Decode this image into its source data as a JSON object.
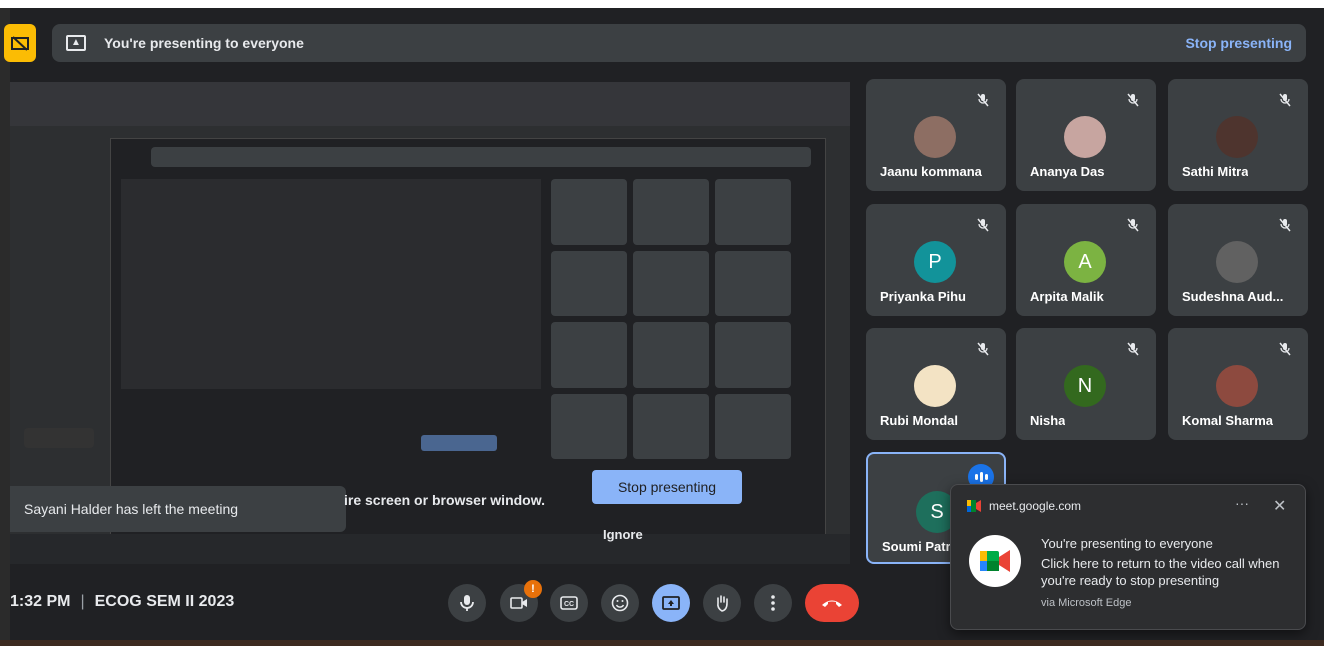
{
  "banner": {
    "text": "You're presenting to everyone",
    "stop_label": "Stop presenting"
  },
  "share_preview": {
    "notice": "Sayani Halder has left the meeting",
    "warning_text": "ire screen or browser window.",
    "stop_button": "Stop presenting",
    "ignore_label": "Ignore"
  },
  "participants": [
    {
      "name": "Jaanu kommana",
      "initial": "",
      "color": "#8d6e63"
    },
    {
      "name": "Ananya Das",
      "initial": "",
      "color": "#c7a5a0"
    },
    {
      "name": "Sathi Mitra",
      "initial": "",
      "color": "#4e342e"
    },
    {
      "name": "Priyanka Pihu",
      "initial": "P",
      "color": "#12939a"
    },
    {
      "name": "Arpita Malik",
      "initial": "A",
      "color": "#7cb342"
    },
    {
      "name": "Sudeshna Aud...",
      "initial": "",
      "color": "#616161"
    },
    {
      "name": "Rubi Mondal",
      "initial": "",
      "color": "#f3e3c4"
    },
    {
      "name": "Nisha",
      "initial": "N",
      "color": "#33691e"
    },
    {
      "name": "Komal Sharma",
      "initial": "",
      "color": "#8d4a3f"
    },
    {
      "name": "Soumi Patr",
      "initial": "S",
      "color": "#1e6f5c"
    }
  ],
  "footer": {
    "time": "1:32 PM",
    "meeting_name": "ECOG SEM II 2023",
    "camera_alert": "!"
  },
  "toast": {
    "site": "meet.google.com",
    "more": "···",
    "close": "✕",
    "title": "You're presenting to everyone",
    "body": "Click here to return to the video call when you're ready to stop presenting",
    "via": "via Microsoft Edge"
  },
  "colors": {
    "accent": "#8ab4f8",
    "end_call": "#ea4335",
    "tile_bg": "#3c4043",
    "background": "#202124",
    "warning": "#fbbc04"
  }
}
